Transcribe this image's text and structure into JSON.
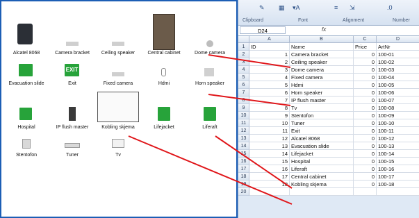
{
  "palette": {
    "items": [
      {
        "label": "Alcatel 8068",
        "icon": "desk-phone-icon"
      },
      {
        "label": "Camera bracket",
        "icon": "camera-bracket-icon"
      },
      {
        "label": "Ceiling speaker",
        "icon": "ceiling-speaker-icon"
      },
      {
        "label": "Central cabinet",
        "icon": "cabinet-icon"
      },
      {
        "label": "Dome camera",
        "icon": "dome-camera-icon"
      },
      {
        "label": "Evacuation slide",
        "icon": "evacuation-slide-icon"
      },
      {
        "label": "Exit",
        "icon": "exit-sign-icon",
        "sign": "EXIT"
      },
      {
        "label": "Fixed camera",
        "icon": "fixed-camera-icon"
      },
      {
        "label": "Hdmi",
        "icon": "hdmi-icon"
      },
      {
        "label": "Horn speaker",
        "icon": "horn-speaker-icon"
      },
      {
        "label": "Hospital",
        "icon": "hospital-icon"
      },
      {
        "label": "IP flush master",
        "icon": "intercom-icon"
      },
      {
        "label": "Kobling skjema",
        "icon": "wiring-diagram-icon"
      },
      {
        "label": "Lifejacket",
        "icon": "lifejacket-icon"
      },
      {
        "label": "Liferaft",
        "icon": "liferaft-icon"
      },
      {
        "label": "Stentofon",
        "icon": "stentofon-icon"
      },
      {
        "label": "Tuner",
        "icon": "tuner-icon"
      },
      {
        "label": "Tv",
        "icon": "tv-icon"
      }
    ]
  },
  "excel": {
    "ribbon": {
      "groups": [
        "Clipboard",
        "Font",
        "Alignment",
        "Number"
      ]
    },
    "namebox": "D24",
    "fx": "fx",
    "columns": [
      "A",
      "B",
      "C",
      "D"
    ],
    "header_row": {
      "a": "ID",
      "b": "Name",
      "c": "Price",
      "d": "ArtNr"
    },
    "rows": [
      {
        "n": "2",
        "a": "1",
        "b": "Camera bracket",
        "c": "0",
        "d": "100-01"
      },
      {
        "n": "3",
        "a": "2",
        "b": "Ceiling speaker",
        "c": "0",
        "d": "100-02"
      },
      {
        "n": "4",
        "a": "3",
        "b": "Dome camera",
        "c": "0",
        "d": "100-03"
      },
      {
        "n": "5",
        "a": "4",
        "b": "Fixed camera",
        "c": "0",
        "d": "100-04"
      },
      {
        "n": "6",
        "a": "5",
        "b": "Hdmi",
        "c": "0",
        "d": "100-05"
      },
      {
        "n": "7",
        "a": "6",
        "b": "Horn speaker",
        "c": "0",
        "d": "100-06"
      },
      {
        "n": "8",
        "a": "7",
        "b": "IP flush master",
        "c": "0",
        "d": "100-07"
      },
      {
        "n": "9",
        "a": "8",
        "b": "Tv",
        "c": "0",
        "d": "100-08"
      },
      {
        "n": "10",
        "a": "9",
        "b": "Stentofon",
        "c": "0",
        "d": "100-09"
      },
      {
        "n": "11",
        "a": "10",
        "b": "Tuner",
        "c": "0",
        "d": "100-10"
      },
      {
        "n": "12",
        "a": "11",
        "b": "Exit",
        "c": "0",
        "d": "100-11"
      },
      {
        "n": "13",
        "a": "12",
        "b": "Alcatel 8068",
        "c": "0",
        "d": "100-12"
      },
      {
        "n": "14",
        "a": "13",
        "b": "Evacuation slide",
        "c": "0",
        "d": "100-13"
      },
      {
        "n": "15",
        "a": "14",
        "b": "Lifejacket",
        "c": "0",
        "d": "100-14"
      },
      {
        "n": "16",
        "a": "15",
        "b": "Hospital",
        "c": "0",
        "d": "100-15"
      },
      {
        "n": "17",
        "a": "16",
        "b": "Liferaft",
        "c": "0",
        "d": "100-16"
      },
      {
        "n": "18",
        "a": "17",
        "b": "Central cabinet",
        "c": "0",
        "d": "100-17"
      },
      {
        "n": "19",
        "a": "18",
        "b": "Kobling skjema",
        "c": "0",
        "d": "100-18"
      },
      {
        "n": "20",
        "a": "",
        "b": "",
        "c": "",
        "d": ""
      }
    ]
  },
  "colors": {
    "arrow": "#e0161a",
    "frame": "#1c5eb5",
    "green": "#27a33a"
  }
}
